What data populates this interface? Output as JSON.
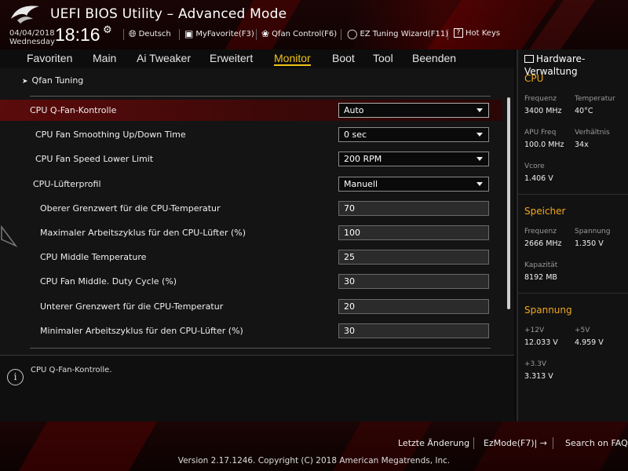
{
  "header": {
    "title": "UEFI BIOS Utility – Advanced Mode",
    "date": "04/04/2018",
    "weekday": "Wednesday",
    "time": "18:16",
    "tools": [
      {
        "label": "Deutsch",
        "icon": "globe-icon"
      },
      {
        "label": "MyFavorite(F3)",
        "icon": "favorite-icon"
      },
      {
        "label": "Qfan Control(F6)",
        "icon": "fan-icon"
      },
      {
        "label": "EZ Tuning Wizard(F11)",
        "icon": "bulb-icon"
      },
      {
        "label": "Hot Keys",
        "icon": "help-icon"
      }
    ]
  },
  "nav": {
    "tabs": [
      "Favoriten",
      "Main",
      "Ai Tweaker",
      "Erweitert",
      "Monitor",
      "Boot",
      "Tool",
      "Beenden"
    ],
    "active": "Monitor"
  },
  "main": {
    "breadcrumb": "Qfan Tuning",
    "rows": [
      {
        "label": "CPU Q-Fan-Kontrolle",
        "type": "select",
        "value": "Auto"
      },
      {
        "label": "CPU Fan Smoothing Up/Down Time",
        "type": "select",
        "value": "0 sec"
      },
      {
        "label": "CPU Fan Speed Lower Limit",
        "type": "select",
        "value": "200 RPM"
      },
      {
        "label": "CPU-Lüfterprofil",
        "type": "select",
        "value": "Manuell"
      },
      {
        "label": "Oberer Grenzwert für die CPU-Temperatur",
        "type": "number",
        "value": "70"
      },
      {
        "label": "Maximaler Arbeitszyklus für den CPU-Lüfter (%)",
        "type": "number",
        "value": "100"
      },
      {
        "label": "CPU Middle Temperature",
        "type": "number",
        "value": "25"
      },
      {
        "label": "CPU Fan Middle. Duty Cycle (%)",
        "type": "number",
        "value": "30"
      },
      {
        "label": "Unterer Grenzwert für die CPU-Temperatur",
        "type": "number",
        "value": "20"
      },
      {
        "label": "Minimaler Arbeitszyklus für den CPU-Lüfter (%)",
        "type": "number",
        "value": "30"
      }
    ]
  },
  "help": {
    "text": "CPU Q-Fan-Kontrolle."
  },
  "panel": {
    "title": "Hardware-Verwaltung",
    "cpu": {
      "title": "CPU",
      "freq_label": "Frequenz",
      "freq_value": "3400 MHz",
      "temp_label": "Temperatur",
      "temp_value": "40°C",
      "apu_label": "APU Freq",
      "apu_value": "100.0 MHz",
      "ratio_label": "Verhältnis",
      "ratio_value": "34x",
      "vcore_label": "Vcore",
      "vcore_value": "1.406 V"
    },
    "memory": {
      "title": "Speicher",
      "freq_label": "Frequenz",
      "freq_value": "2666 MHz",
      "volt_label": "Spannung",
      "volt_value": "1.350 V",
      "cap_label": "Kapazität",
      "cap_value": "8192 MB"
    },
    "voltage": {
      "title": "Spannung",
      "v12_label": "+12V",
      "v12_value": "12.033 V",
      "v5_label": "+5V",
      "v5_value": "4.959 V",
      "v33_label": "+3.3V",
      "v33_value": "3.313 V"
    }
  },
  "footer": {
    "last_change": "Letzte Änderung",
    "ezmode": "EzMode(F7)|",
    "search": "Search on FAQ",
    "version": "Version 2.17.1246. Copyright (C) 2018 American Megatrends, Inc."
  },
  "colors": {
    "accent": "#f0c419",
    "section": "#f0a81c",
    "selected_row": "#5a0b0b"
  }
}
